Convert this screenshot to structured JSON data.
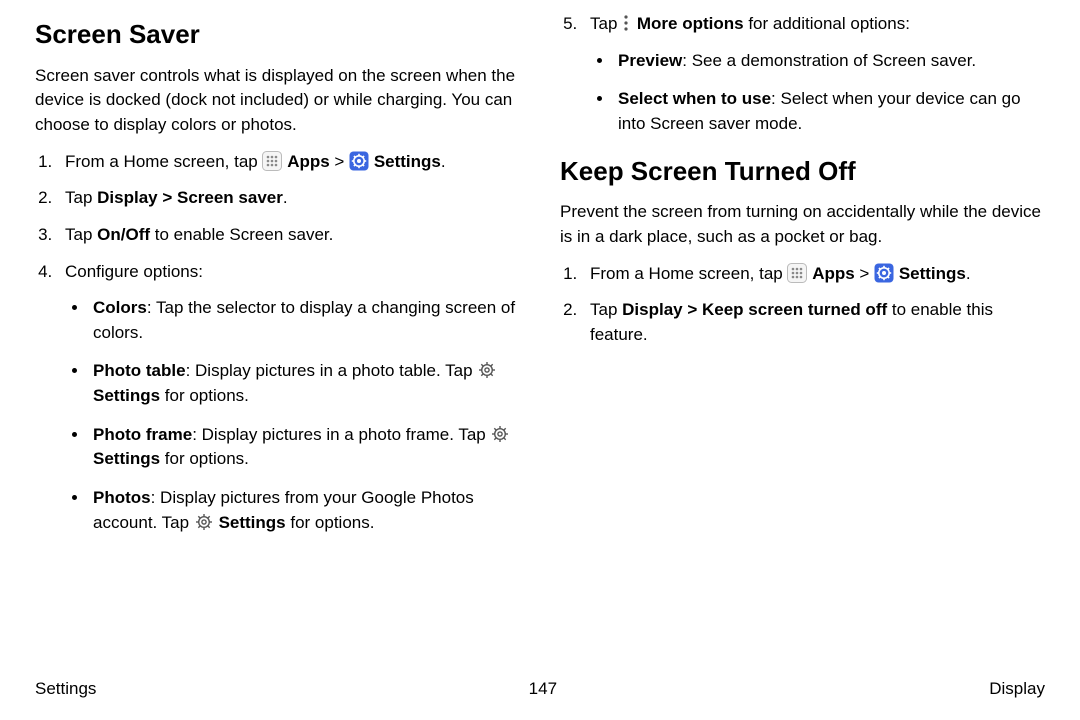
{
  "col1": {
    "heading": "Screen Saver",
    "intro": "Screen saver controls what is displayed on the screen when the device is docked (dock not included) or while charging. You can choose to display colors or photos.",
    "step1_a": "From a Home screen, tap ",
    "step1_apps": "Apps",
    "step1_sep": " > ",
    "step1_settings": "Settings",
    "step1_end": ".",
    "step2_a": "Tap ",
    "step2_b": "Display > Screen saver",
    "step2_c": ".",
    "step3_a": "Tap ",
    "step3_b": "On/Off",
    "step3_c": " to enable Screen saver.",
    "step4": "Configure options:",
    "b1_a": "Colors",
    "b1_b": ": Tap the selector to display a changing screen of colors.",
    "b2_a": "Photo table",
    "b2_b": ": Display pictures in a photo table. Tap ",
    "b2_c": "Settings",
    "b2_d": " for options.",
    "b3_a": "Photo frame",
    "b3_b": ": Display pictures in a photo frame. Tap ",
    "b3_c": "Settings",
    "b3_d": " for options.",
    "b4_a": "Photos",
    "b4_b": ": Display pictures from your Google Photos account. Tap ",
    "b4_c": "Settings",
    "b4_d": " for options."
  },
  "col2": {
    "step5_a": "Tap ",
    "step5_b": "More options",
    "step5_c": " for additional options:",
    "b1_a": "Preview",
    "b1_b": ": See a demonstration of Screen saver.",
    "b2_a": "Select when to use",
    "b2_b": ": Select when your device can go into Screen saver mode.",
    "heading": "Keep Screen Turned Off",
    "intro": "Prevent the screen from turning on accidentally while the device is in a dark place, such as a pocket or bag.",
    "step1_a": "From a Home screen, tap ",
    "step1_apps": "Apps",
    "step1_sep": " > ",
    "step1_settings": "Settings",
    "step1_end": ".",
    "step2_a": "Tap ",
    "step2_b": "Display > Keep screen turned off",
    "step2_c": " to enable this feature."
  },
  "footer": {
    "left": "Settings",
    "center": "147",
    "right": "Display"
  }
}
